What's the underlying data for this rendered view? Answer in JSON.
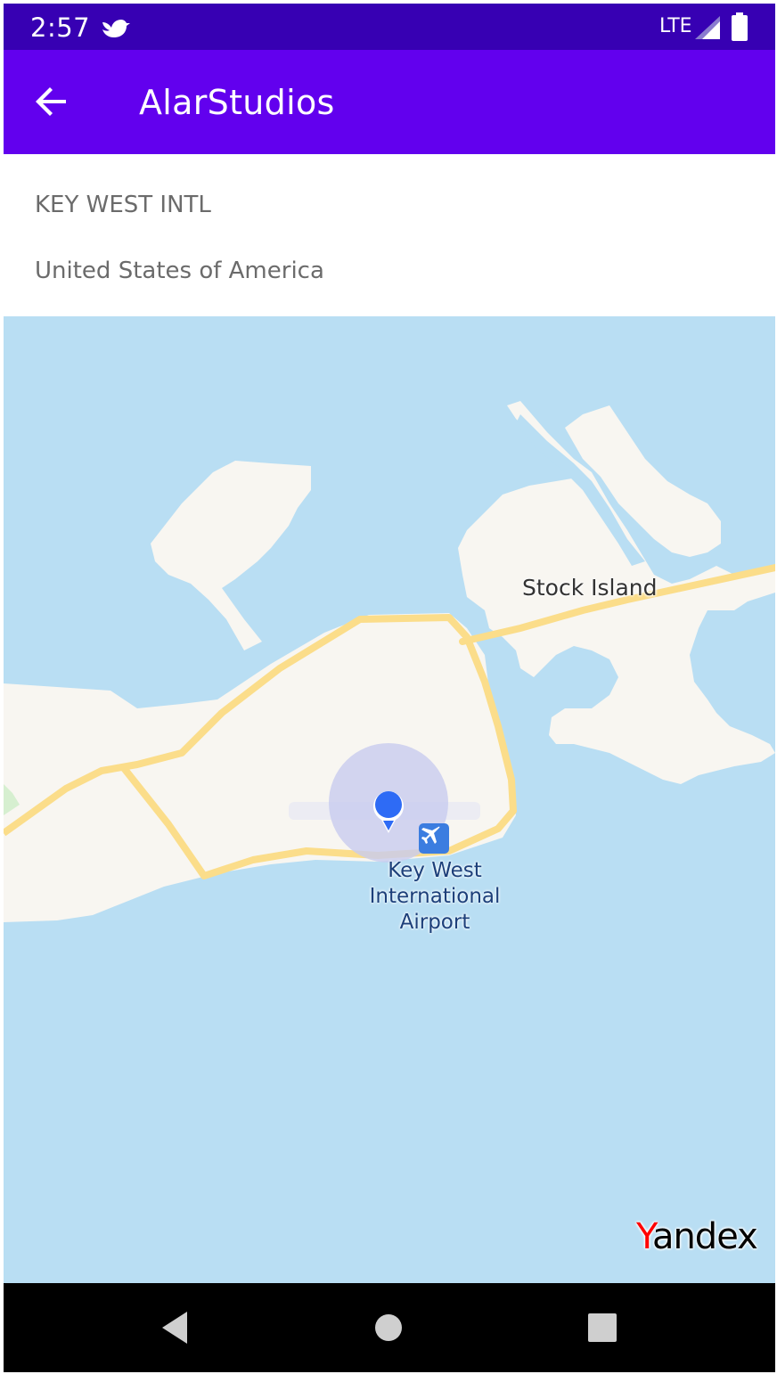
{
  "status_bar": {
    "time": "2:57",
    "network": "LTE",
    "icons": [
      "bird-notification-icon",
      "signal-icon",
      "battery-icon"
    ]
  },
  "app_bar": {
    "title": "AlarStudios",
    "back_icon": "arrow-back-icon",
    "background": "#6200ee",
    "status_background": "#3700b3"
  },
  "airport": {
    "name": "KEY WEST INTL",
    "country": "United States of America"
  },
  "map": {
    "labels": {
      "stock_island": "Stock Island",
      "airport_line1": "Key West",
      "airport_line2": "International",
      "airport_line3": "Airport"
    },
    "provider_first": "Y",
    "provider_rest": "andex",
    "water_color": "#b9def3",
    "land_color": "#f8f6f1",
    "road_color": "#fbdd8a",
    "pin_color": "#2e6bf5"
  },
  "nav_bar": {
    "icons": [
      "nav-back-icon",
      "nav-home-icon",
      "nav-recents-icon"
    ]
  }
}
